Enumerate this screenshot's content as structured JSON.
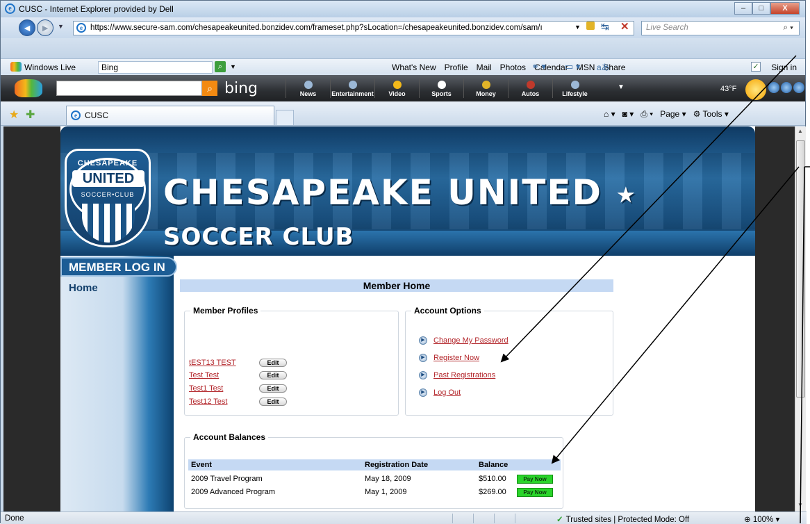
{
  "window": {
    "title": "CUSC - Internet Explorer provided by Dell"
  },
  "address": {
    "url": "https://www.secure-sam.com/chesapeakeunited.bonzidev.com/frameset.php?sLocation=/chesapeakeunited.bonzidev.com/sam/ı",
    "search_placeholder": "Live Search"
  },
  "links_bar": {
    "windows_live": "Windows Live",
    "bing_field": "Bing",
    "links": [
      "What's New",
      "Profile",
      "Mail",
      "Photos",
      "Calendar",
      "MSN",
      "Share"
    ],
    "sign_in": "Sign in"
  },
  "bing_toolbar": {
    "logo": "bing",
    "nav": [
      "News",
      "Entertainment",
      "Video",
      "Sports",
      "Money",
      "Autos",
      "Lifestyle"
    ],
    "temperature": "43°F"
  },
  "tabs": {
    "active": "CUSC"
  },
  "command_bar": {
    "page": "Page",
    "tools": "Tools"
  },
  "site": {
    "banner": {
      "crest_top": "CHESAPEAKE",
      "crest_mid": "UNITED",
      "crest_bottom": "SOCCER•CLUB",
      "title": "CHESAPEAKE UNITED",
      "star": "★",
      "subtitle": "SOCCER CLUB"
    },
    "login_bar": "MEMBER LOG IN",
    "nav_home": "Home",
    "page_heading": "Member Home",
    "profiles": {
      "legend": "Member Profiles",
      "edit_label": "Edit",
      "items": [
        "tEST13 TEST",
        "Test Test",
        "Test1 Test",
        "Test12 Test"
      ]
    },
    "options": {
      "legend": "Account Options",
      "items": [
        "Change My Password",
        "Register Now",
        "Past Registrations",
        "Log Out"
      ]
    },
    "balances": {
      "legend": "Account Balances",
      "headers": [
        "Event",
        "Registration Date",
        "Balance"
      ],
      "rows": [
        {
          "event": "2009 Travel Program",
          "date": "May 18, 2009",
          "balance": "$510.00",
          "action": "Pay Now"
        },
        {
          "event": "2009 Advanced Program",
          "date": "May 1, 2009",
          "balance": "$269.00",
          "action": "Pay Now"
        }
      ]
    }
  },
  "status": {
    "left": "Done",
    "zone": "Trusted sites | Protected Mode: Off",
    "zoom": "100%"
  }
}
